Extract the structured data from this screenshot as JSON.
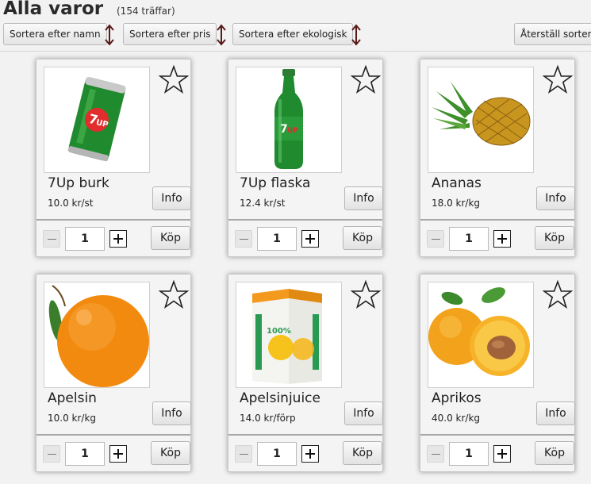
{
  "header": {
    "title": "Alla varor",
    "count": "(154 träffar)",
    "sort_name": "Sortera efter namn",
    "sort_price": "Sortera efter pris",
    "sort_eco": "Sortera efter ekologisk",
    "reset_sort": "Återställ sortering"
  },
  "products": [
    {
      "name": "7Up burk",
      "price": "10.0 kr/st",
      "image": "7up-can-image",
      "qty": "1",
      "info_label": "Info",
      "buy_label": "Köp"
    },
    {
      "name": "7Up flaska",
      "price": "12.4 kr/st",
      "image": "7up-bottle-image",
      "qty": "1",
      "info_label": "Info",
      "buy_label": "Köp"
    },
    {
      "name": "Ananas",
      "price": "18.0 kr/kg",
      "image": "pineapple-image",
      "qty": "1",
      "info_label": "Info",
      "buy_label": "Köp"
    },
    {
      "name": "Apelsin",
      "price": "10.0 kr/kg",
      "image": "orange-image",
      "qty": "1",
      "info_label": "Info",
      "buy_label": "Köp"
    },
    {
      "name": "Apelsinjuice",
      "price": "14.0 kr/förp",
      "image": "orange-juice-carton-image",
      "qty": "1",
      "info_label": "Info",
      "buy_label": "Köp"
    },
    {
      "name": "Aprikos",
      "price": "40.0 kr/kg",
      "image": "apricot-image",
      "qty": "1",
      "info_label": "Info",
      "buy_label": "Köp"
    }
  ],
  "colors": {
    "sort_arrow": "#5a1a1a",
    "card_background": "#f4f4f4",
    "page_background": "#f2f2f2"
  }
}
